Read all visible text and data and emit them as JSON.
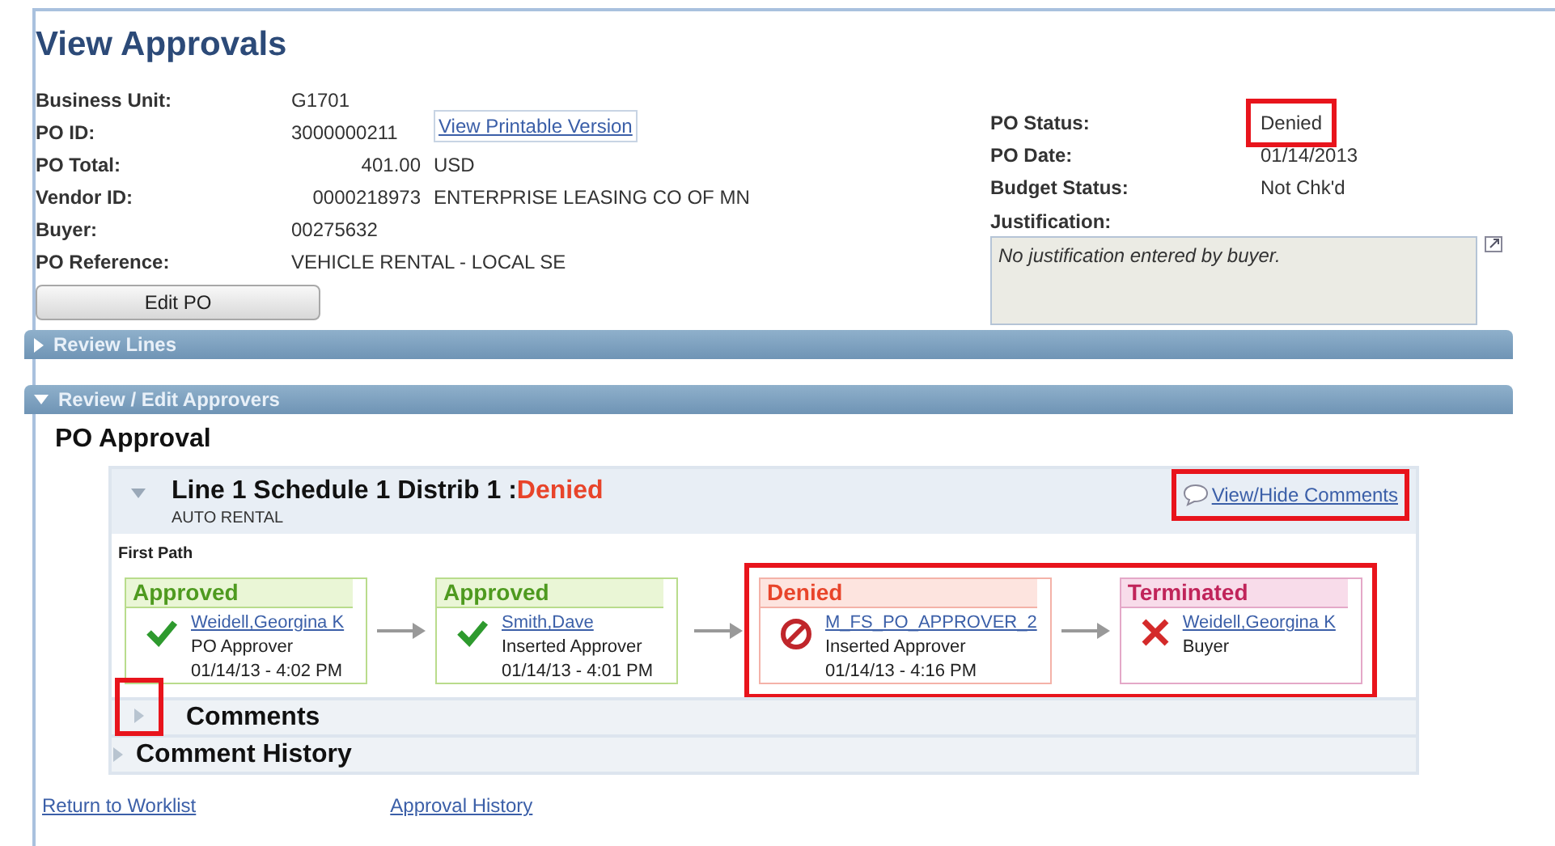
{
  "title": "View Approvals",
  "left_fields": [
    {
      "label": "Business Unit:",
      "value": "G1701"
    },
    {
      "label": "PO ID:",
      "value": "3000000211",
      "link": "View Printable Version"
    },
    {
      "label": "PO Total:",
      "value": "401.00",
      "extra": "USD"
    },
    {
      "label": "Vendor ID:",
      "value": "0000218973",
      "extra": "ENTERPRISE LEASING CO OF MN"
    },
    {
      "label": "Buyer:",
      "value": "00275632"
    },
    {
      "label": "PO Reference:",
      "value": "VEHICLE RENTAL - LOCAL SE"
    }
  ],
  "right_fields": [
    {
      "label": "PO Status:",
      "value": "Denied",
      "highlighted": true
    },
    {
      "label": "PO Date:",
      "value": "01/14/2013",
      "highlighted": false
    },
    {
      "label": "Budget Status:",
      "value": "Not Chk'd",
      "highlighted": false
    }
  ],
  "justification": {
    "label": "Justification:",
    "value": "No justification entered by buyer."
  },
  "edit_button": "Edit PO",
  "sections": [
    {
      "title": "Review Lines",
      "expanded": false
    },
    {
      "title": "Review / Edit Approvers",
      "expanded": true
    }
  ],
  "approval": {
    "title": "PO Approval",
    "line_title": "Line 1 Schedule 1 Distrib 1 :",
    "line_status": "Denied",
    "line_subtitle": "AUTO RENTAL",
    "comments_link": "View/Hide Comments",
    "comments_link_highlighted": true,
    "path_title": "First Path",
    "steps": [
      {
        "kind": "approved",
        "status": "Approved",
        "name": "Weidell,Georgina K",
        "role": "PO Approver",
        "time": "01/14/13 - 4:02 PM",
        "highlighted": false
      },
      {
        "kind": "approved",
        "status": "Approved",
        "name": "Smith,Dave",
        "role": "Inserted Approver",
        "time": "01/14/13 - 4:01 PM",
        "highlighted": false
      },
      {
        "kind": "denied",
        "status": "Denied",
        "name": "M_FS_PO_APPROVER_2",
        "role": "Inserted Approver",
        "time": "01/14/13 - 4:16 PM",
        "highlighted": true
      },
      {
        "kind": "terminated",
        "status": "Terminated",
        "name": "Weidell,Georgina K",
        "role": "Buyer",
        "highlighted": true
      }
    ],
    "subsections": [
      {
        "title": "Comments",
        "expanded": false,
        "highlighted": true
      },
      {
        "title": "Comment History",
        "expanded": false,
        "highlighted": false
      }
    ]
  },
  "footer_links": [
    "Return to Worklist",
    "Approval History"
  ]
}
